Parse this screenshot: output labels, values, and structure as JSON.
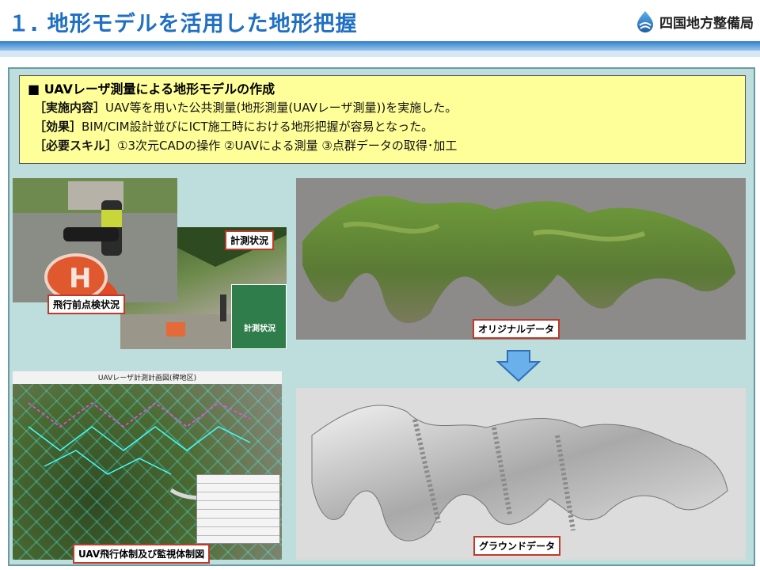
{
  "header": {
    "title": "１. 地形モデルを活用した地形把握",
    "org": "四国地方整備局"
  },
  "info": {
    "heading": "■ UAVレーザ測量による地形モデルの作成",
    "lines": [
      {
        "label": "［実施内容］",
        "text": "UAV等を用いた公共測量(地形測量(UAVレーザ測量))を実施した。"
      },
      {
        "label": "［効果］",
        "text": "BIM/CIM設計並びにICT施工時における地形把握が容易となった。"
      },
      {
        "label": "［必要スキル］",
        "text": "①3次元CADの操作 ②UAVによる測量 ③点群データの取得･加工"
      }
    ]
  },
  "captions": {
    "preflight": "飛行前点検状況",
    "measure": "計測状況",
    "original": "オリジナルデータ",
    "flight": "UAV飛行体制及び監視体制図",
    "ground": "グラウンドデータ"
  },
  "photos": {
    "field_sign": "計測状況",
    "map_title": "UAVレーザ計測計画図(稗地区)"
  },
  "colors": {
    "title": "#1f6fc4",
    "panel": "#bddedd",
    "infobox": "#ffff99",
    "caption_border": "#c0392b",
    "arrow": "#6ab0ea"
  },
  "icons": {
    "logo": "water-drop-logo-icon",
    "arrow": "down-arrow-icon"
  }
}
